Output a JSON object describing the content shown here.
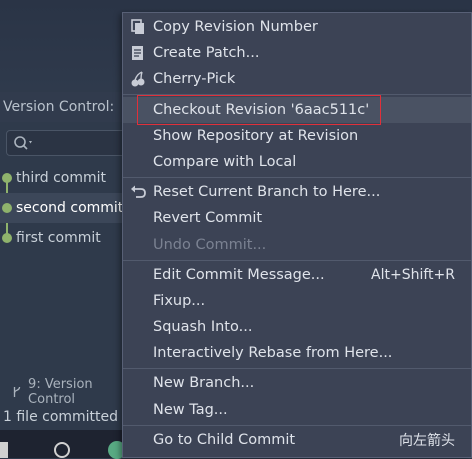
{
  "vc": {
    "header_label": "Version Control:"
  },
  "commits": [
    {
      "label": "third commit"
    },
    {
      "label": "second commit"
    },
    {
      "label": "first commit"
    }
  ],
  "bottom": {
    "tab_label": "9: Version Control",
    "status": "1 file committed"
  },
  "menu": {
    "items": [
      {
        "label": "Copy Revision Number",
        "icon": "copy-icon"
      },
      {
        "label": "Create Patch...",
        "icon": "patch-icon"
      },
      {
        "label": "Cherry-Pick",
        "icon": "cherry-icon"
      },
      {
        "label": "Checkout Revision '6aac511c'"
      },
      {
        "label": "Show Repository at Revision"
      },
      {
        "label": "Compare with Local"
      },
      {
        "label": "Reset Current Branch to Here...",
        "icon": "undo-icon"
      },
      {
        "label": "Revert Commit"
      },
      {
        "label": "Undo Commit..."
      },
      {
        "label": "Edit Commit Message...",
        "shortcut": "Alt+Shift+R"
      },
      {
        "label": "Fixup..."
      },
      {
        "label": "Squash Into..."
      },
      {
        "label": "Interactively Rebase from Here..."
      },
      {
        "label": "New Branch..."
      },
      {
        "label": "New Tag..."
      },
      {
        "label": "Go to Child Commit",
        "shortcut": "向左箭头"
      }
    ]
  },
  "colors": {
    "accent_highlight_border": "#e0303a",
    "graph": "#8fb36c"
  }
}
